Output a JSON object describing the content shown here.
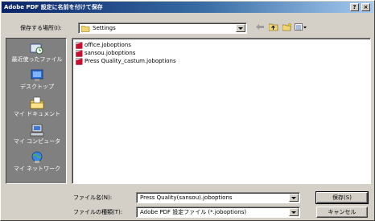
{
  "window": {
    "title": "Adobe PDF 設定に名前を付けて保存"
  },
  "titlebar": {
    "help_label": "?",
    "close_label": "×"
  },
  "toolbar": {
    "save_in_label": "保存する場所(I):",
    "location": "Settings",
    "icons": [
      "back-icon",
      "up-folder-icon",
      "new-folder-icon",
      "view-menu-icon"
    ]
  },
  "places": [
    {
      "label": "最近使ったファイル",
      "icon": "recent-icon"
    },
    {
      "label": "デスクトップ",
      "icon": "desktop-icon"
    },
    {
      "label": "マイ ドキュメント",
      "icon": "my-documents-icon"
    },
    {
      "label": "マイ コンピュータ",
      "icon": "my-computer-icon"
    },
    {
      "label": "マイ ネットワーク",
      "icon": "my-network-icon"
    }
  ],
  "files": [
    {
      "name": "office.joboptions"
    },
    {
      "name": "sansou.joboptions"
    },
    {
      "name": "Press Quality_castum.joboptions"
    }
  ],
  "footer": {
    "filename_label": "ファイル名(N):",
    "filename_value": "Press Quality(sansou).joboptions",
    "filetype_label": "ファイルの種類(T):",
    "filetype_value": "Adobe PDF 設定ファイル (*.joboptions)",
    "save_label": "保存(S)",
    "cancel_label": "キャンセル"
  },
  "colors": {
    "title_start": "#0a246a",
    "title_end": "#a6caf0",
    "dialog_bg": "#d4d0c8",
    "places_bg": "#808080",
    "file_icon": "#c8102e"
  }
}
